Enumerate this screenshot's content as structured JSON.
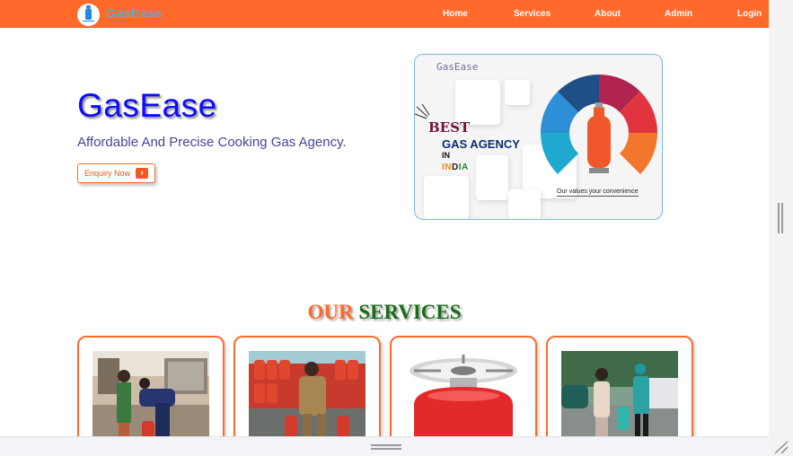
{
  "navbar": {
    "brand": "GasEase",
    "links": [
      "Home",
      "Services",
      "About",
      "Admin",
      "Login"
    ]
  },
  "hero": {
    "title": "GasEase",
    "subtitle": "Affordable And Precise Cooking Gas Agency.",
    "cta_label": "Enquiry Now",
    "cta_icon": "chevron-right-icon"
  },
  "banner": {
    "watermark": "GasEase",
    "best": "BEST",
    "headline": "GAS AGENCY",
    "in": "IN",
    "india": [
      "I",
      "N",
      "D",
      "I",
      "A"
    ],
    "tagline": "Our values your convenience"
  },
  "services": {
    "title_part1": "OUR",
    "title_part2": "SERVICES",
    "cards": [
      {
        "image": "gas-connection-photo"
      },
      {
        "image": "cylinder-delivery-photo"
      },
      {
        "image": "gas-stove-photo"
      },
      {
        "image": "doorstep-service-photo"
      }
    ]
  },
  "colors": {
    "nav_bg": "#ff6a2b",
    "brand_text": "#2ec0ff",
    "hero_title": "#0b0bff",
    "accent": "#ff6a2b",
    "services_green": "#1b6b1b"
  }
}
